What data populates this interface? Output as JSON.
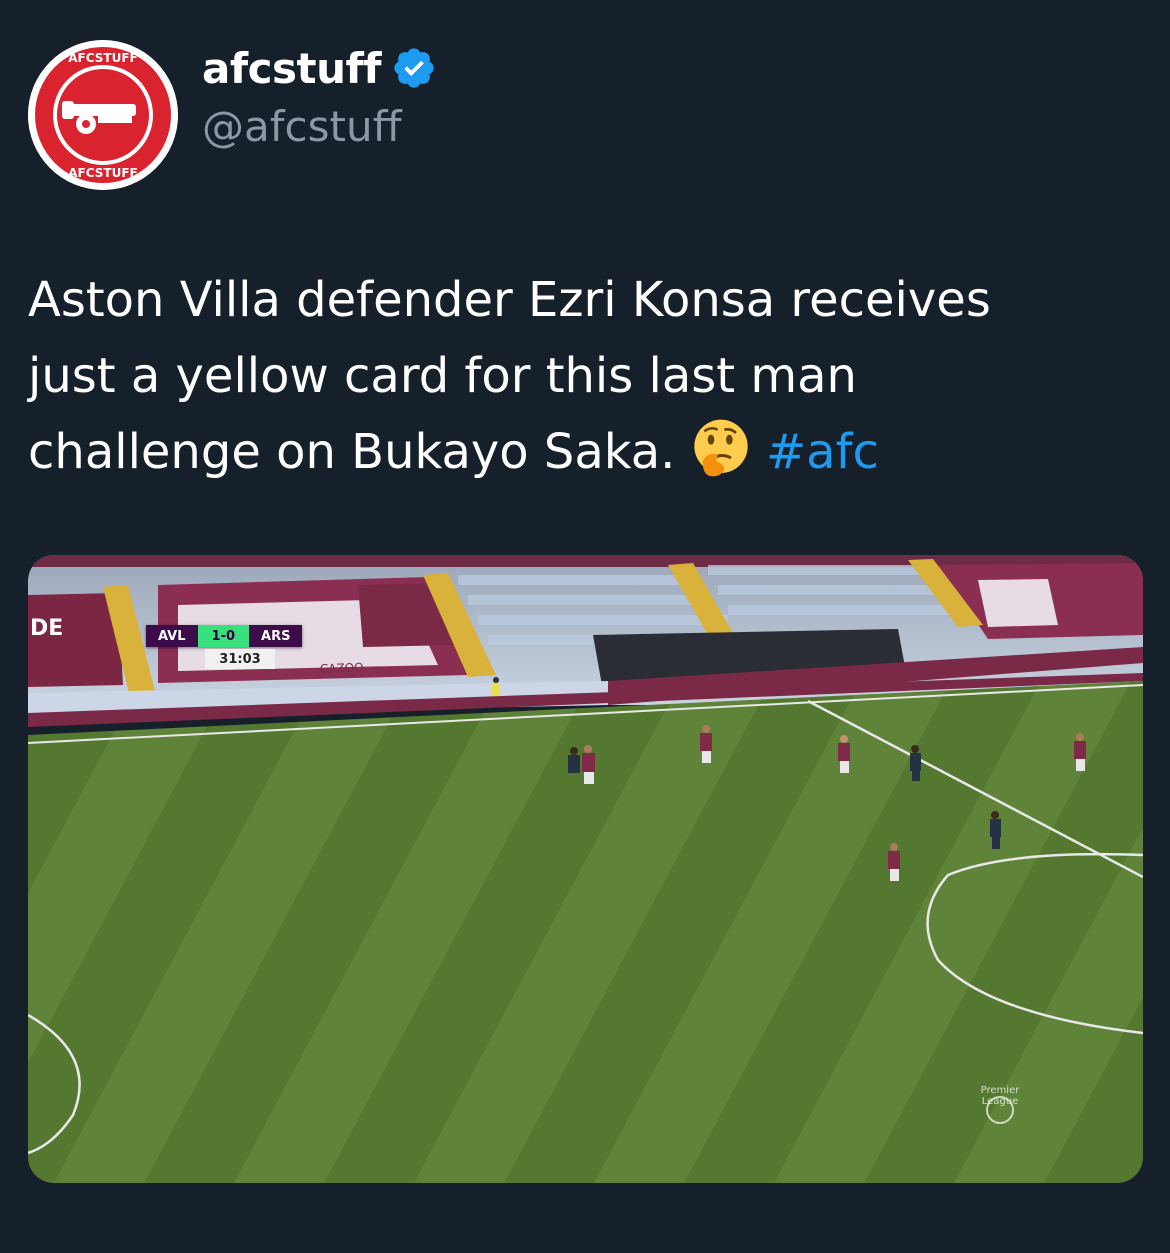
{
  "author": {
    "display_name": "afcstuff",
    "handle": "@afcstuff",
    "verified": true,
    "avatar_icon": "afcstuff-cannon-logo",
    "avatar_ring_text": "AFCSTUFF",
    "avatar_color": "#d9232e"
  },
  "tweet": {
    "text_line1": "Aston Villa defender Ezri Konsa receives",
    "text_line2": "just a yellow card for this last man",
    "text_line3": "challenge on Bukayo Saka.",
    "emoji": "thinking-face-emoji",
    "hashtag": "#afc",
    "hashtag_color": "#1d9bf0"
  },
  "media": {
    "type": "video-frame",
    "scoreboard": {
      "home": "AVL",
      "score": "1-0",
      "away": "ARS",
      "clock": "31:03"
    },
    "pitch_board_text": "CAZOO",
    "stand_text": "THE\nDE",
    "league_logo_text": "Premier League"
  },
  "colors": {
    "background": "#15202b",
    "secondary_text": "#8b98a5",
    "verified_badge": "#1d9bf0",
    "pitch_green": "#5a7d36"
  }
}
